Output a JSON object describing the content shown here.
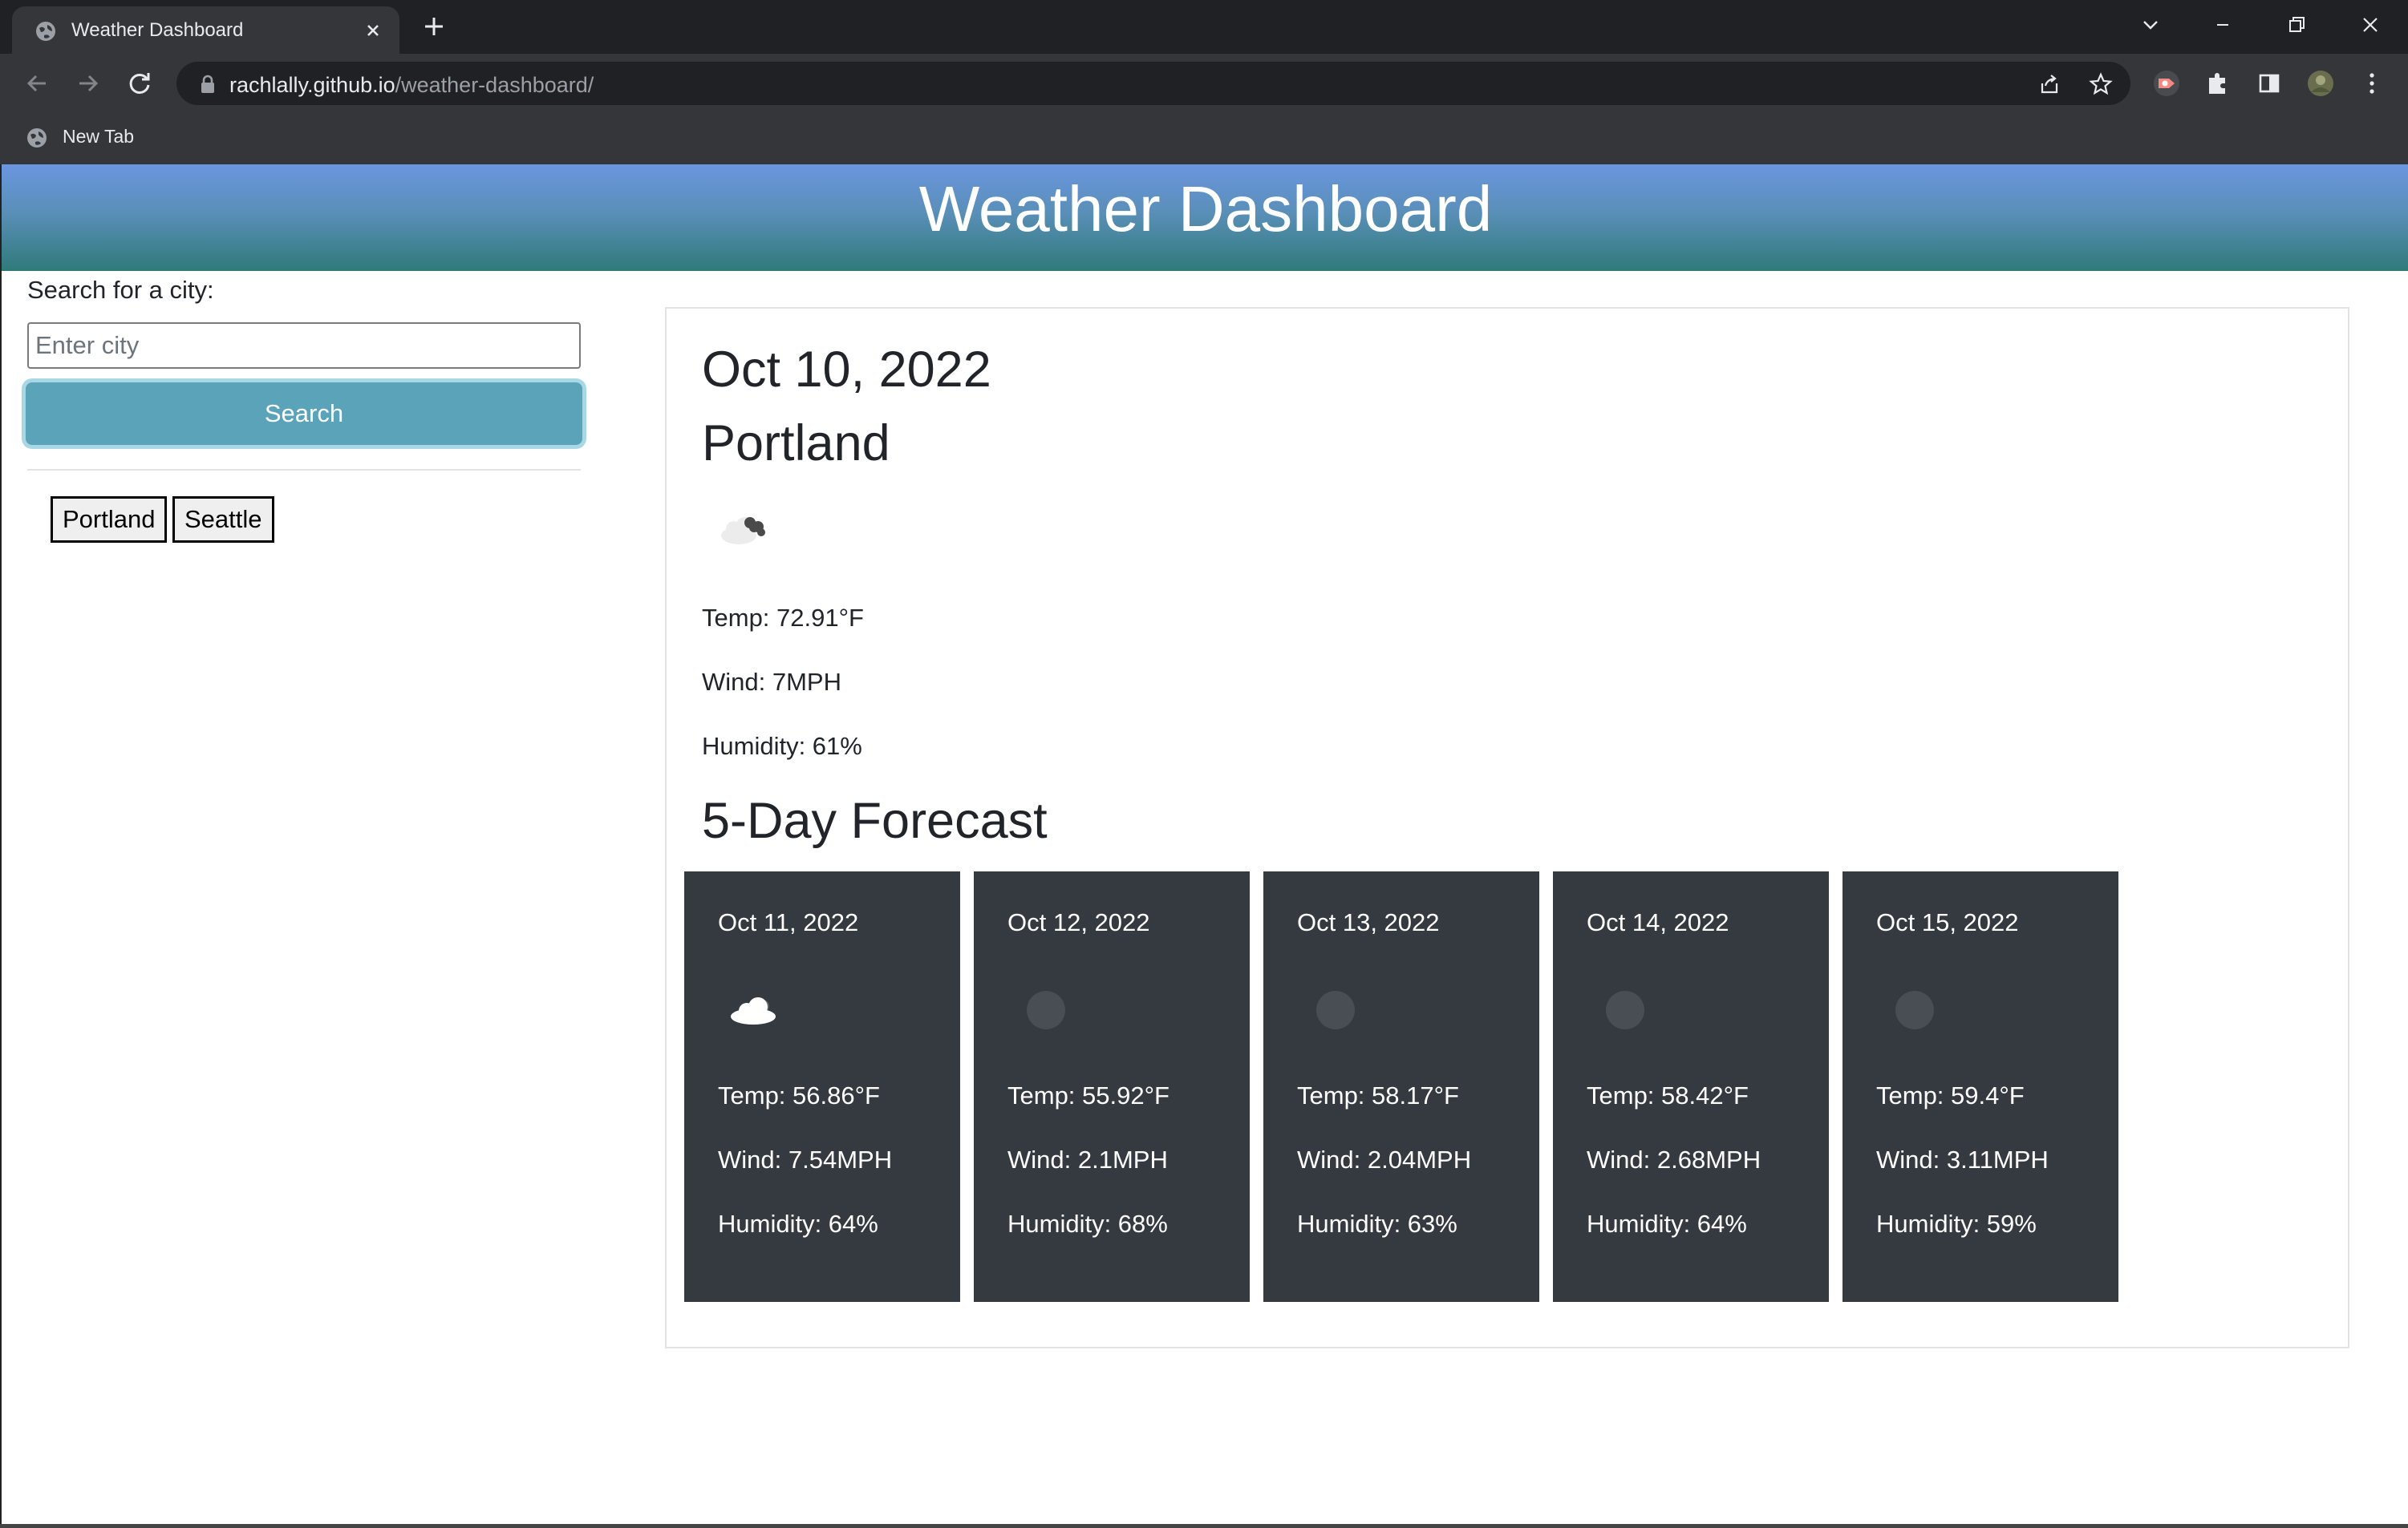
{
  "browser": {
    "tab_title": "Weather Dashboard",
    "url_host": "rachlally.github.io",
    "url_path": "/weather-dashboard/",
    "bookmark_label": "New Tab"
  },
  "header": {
    "title": "Weather Dashboard"
  },
  "sidebar": {
    "search_label": "Search for a city:",
    "search_placeholder": "Enter city",
    "search_value": "",
    "search_button": "Search",
    "history": [
      "Portland",
      "Seattle"
    ]
  },
  "current": {
    "date": "Oct 10, 2022",
    "city": "Portland",
    "icon": "partly-cloudy-icon",
    "temp": "Temp: 72.91°F",
    "wind": "Wind: 7MPH",
    "humidity": "Humidity: 61%"
  },
  "forecast": {
    "title": "5-Day Forecast",
    "days": [
      {
        "date": "Oct 11, 2022",
        "icon": "cloud-icon",
        "temp": "Temp: 56.86°F",
        "wind": "Wind: 7.54MPH",
        "humidity": "Humidity: 64%"
      },
      {
        "date": "Oct 12, 2022",
        "icon": "clear-icon",
        "temp": "Temp: 55.92°F",
        "wind": "Wind: 2.1MPH",
        "humidity": "Humidity: 68%"
      },
      {
        "date": "Oct 13, 2022",
        "icon": "clear-icon",
        "temp": "Temp: 58.17°F",
        "wind": "Wind: 2.04MPH",
        "humidity": "Humidity: 63%"
      },
      {
        "date": "Oct 14, 2022",
        "icon": "clear-icon",
        "temp": "Temp: 58.42°F",
        "wind": "Wind: 2.68MPH",
        "humidity": "Humidity: 64%"
      },
      {
        "date": "Oct 15, 2022",
        "icon": "clear-icon",
        "temp": "Temp: 59.4°F",
        "wind": "Wind: 3.11MPH",
        "humidity": "Humidity: 59%"
      }
    ]
  },
  "colors": {
    "header_top": "#6a96e0",
    "header_bottom": "#2f7a7a",
    "search_button": "#5ba3b8",
    "card_bg": "#343a40"
  }
}
